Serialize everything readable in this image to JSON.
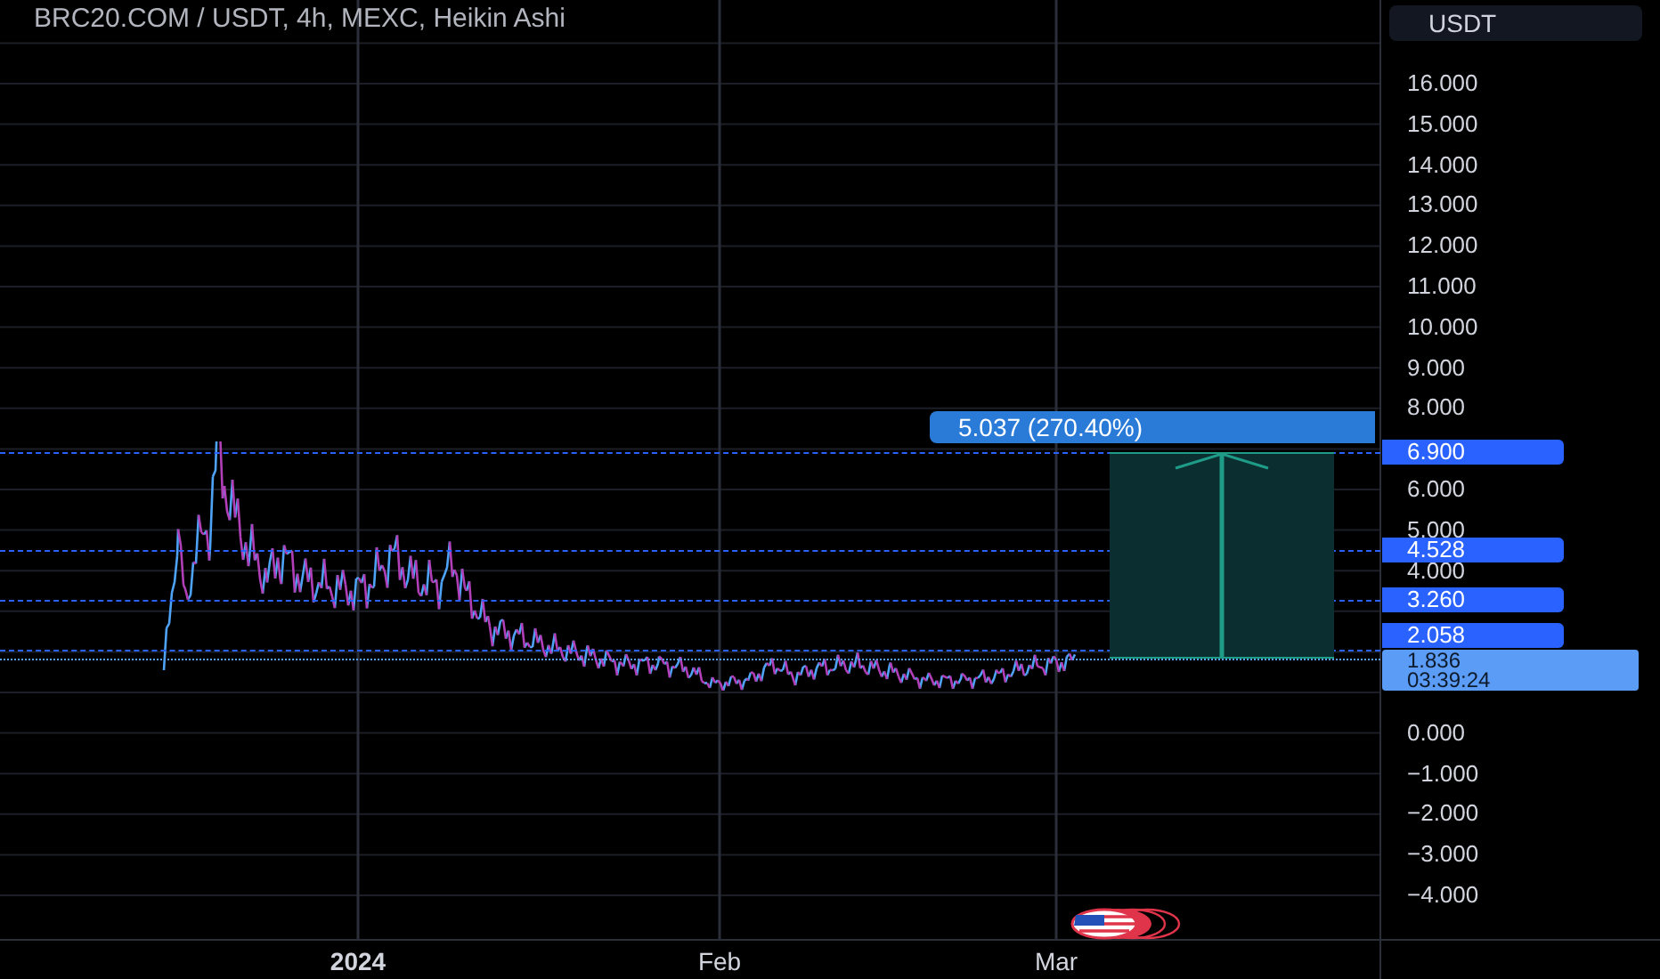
{
  "title": "BRC20.COM / USDT, 4h, MEXC, Heikin Ashi",
  "currency_button": "USDT",
  "price_axis_ticks": [
    "16.000",
    "15.000",
    "14.000",
    "13.000",
    "12.000",
    "11.000",
    "10.000",
    "9.000",
    "8.000",
    "6.000",
    "5.000",
    "4.000",
    "0.000",
    "−1.000",
    "−2.000",
    "−3.000",
    "−4.000"
  ],
  "price_lines": [
    {
      "kind": "level",
      "label": "6.900"
    },
    {
      "kind": "level",
      "label": "4.528"
    },
    {
      "kind": "level",
      "label": "3.260"
    },
    {
      "kind": "level",
      "label": "2.058"
    },
    {
      "kind": "last",
      "label": "1.836",
      "countdown": "03:39:24"
    }
  ],
  "measure": {
    "label": "5.037 (270.40%)"
  },
  "time_axis": [
    "2024",
    "Feb",
    "Mar"
  ]
}
